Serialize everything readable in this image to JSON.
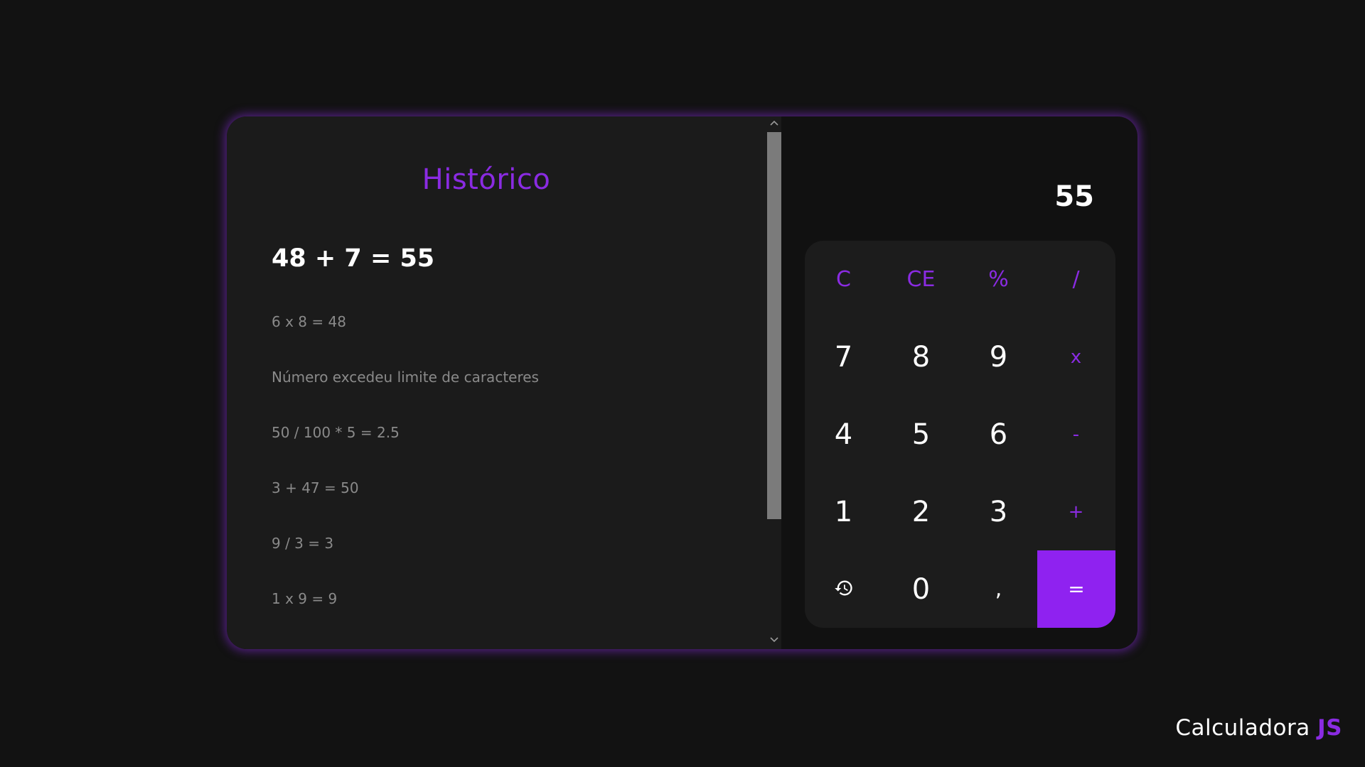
{
  "history": {
    "title": "Histórico",
    "items": [
      "48 + 7 = 55",
      "6 x 8 = 48",
      "Número excedeu limite de caracteres",
      "50 / 100 * 5 = 2.5",
      "3 + 47 = 50",
      "9 / 3 = 3",
      "1 x 9 = 9"
    ]
  },
  "display": {
    "value": "55"
  },
  "keys": {
    "clear": "C",
    "clear_entry": "CE",
    "percent": "%",
    "divide": "/",
    "seven": "7",
    "eight": "8",
    "nine": "9",
    "multiply": "x",
    "four": "4",
    "five": "5",
    "six": "6",
    "minus": "-",
    "one": "1",
    "two": "2",
    "three": "3",
    "plus": "+",
    "history_icon": "history-icon",
    "zero": "0",
    "comma": ",",
    "equals": "="
  },
  "brand": {
    "name": "Calculadora",
    "accent": "JS"
  },
  "colors": {
    "accent": "#8a2be2",
    "equals_background": "#8f22f0",
    "page_background": "#121212",
    "panel_background": "#1b1b1b"
  }
}
